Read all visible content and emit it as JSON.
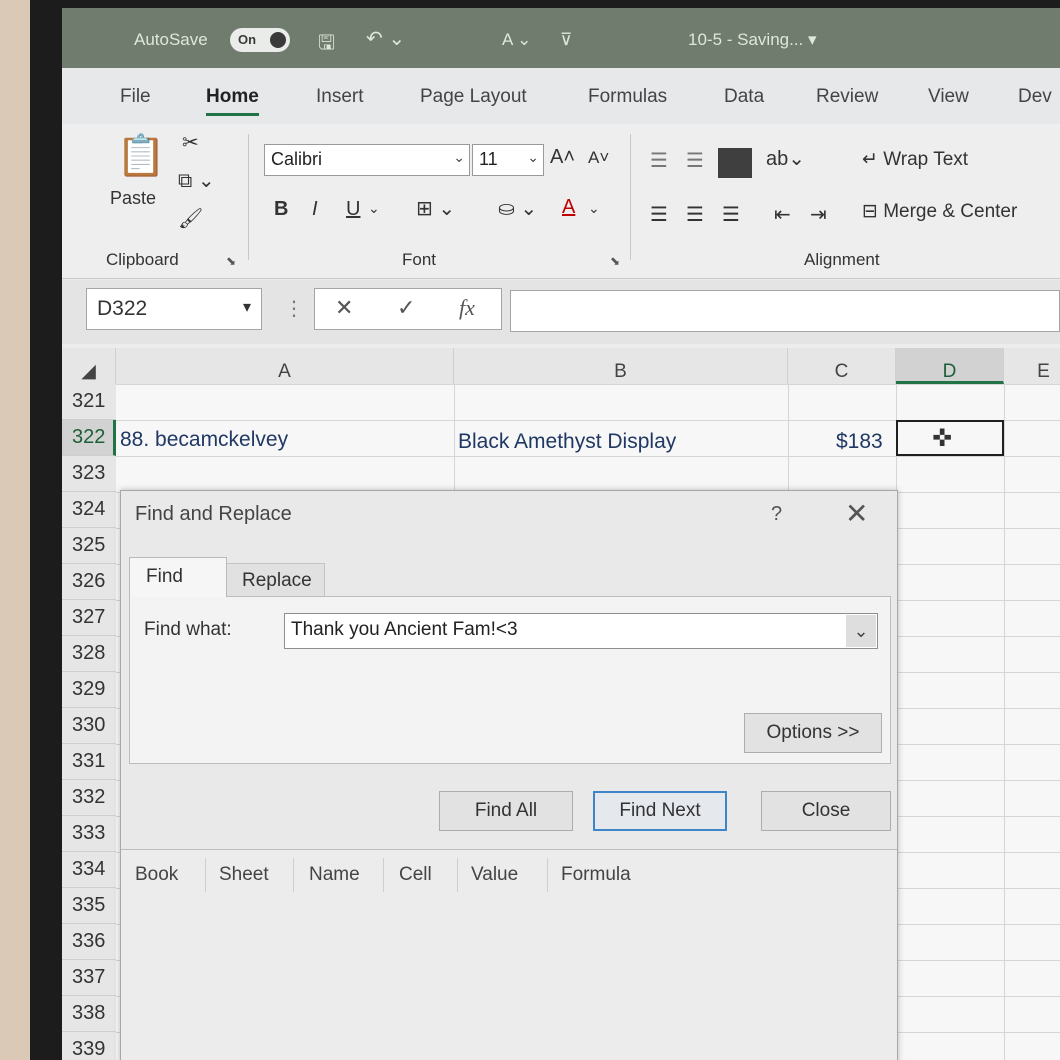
{
  "titlebar": {
    "autosave_label": "AutoSave",
    "autosave_state": "On",
    "doc_title": "10-5 - Saving... ▾"
  },
  "ribbon_tabs": [
    "File",
    "Home",
    "Insert",
    "Page Layout",
    "Formulas",
    "Data",
    "Review",
    "View",
    "Dev"
  ],
  "ribbon": {
    "paste_label": "Paste",
    "clipboard_label": "Clipboard",
    "font_label": "Font",
    "alignment_label": "Alignment",
    "font_name": "Calibri",
    "font_size": "11",
    "bold": "B",
    "italic": "I",
    "underline": "U",
    "font_color": "A",
    "wrap_text": "Wrap Text",
    "merge_center": "Merge & Center"
  },
  "formula_bar": {
    "name_box": "D322",
    "formula": ""
  },
  "grid": {
    "columns": [
      "A",
      "B",
      "C",
      "D",
      "E"
    ],
    "rows": [
      "321",
      "322",
      "323",
      "324",
      "325",
      "326",
      "327",
      "328",
      "329",
      "330",
      "331",
      "332",
      "333",
      "334",
      "335",
      "336",
      "337",
      "338",
      "339"
    ],
    "row322": {
      "a": "88. becamckelvey",
      "b": "Black Amethyst Display",
      "c": "$183"
    },
    "selected_cell": "D322"
  },
  "dialog": {
    "title": "Find and Replace",
    "help": "?",
    "tab_find": "Find",
    "tab_replace": "Replace",
    "find_what_label": "Find what:",
    "find_what_value": "Thank you Ancient Fam!<3",
    "options_button": "Options >>",
    "find_all_button": "Find All",
    "find_next_button": "Find Next",
    "close_button": "Close",
    "result_columns": [
      "Book",
      "Sheet",
      "Name",
      "Cell",
      "Value",
      "Formula"
    ]
  },
  "colors": {
    "excel_green": "#217346",
    "titlebar": "#707c6e",
    "focus_blue": "#3e86c9"
  }
}
